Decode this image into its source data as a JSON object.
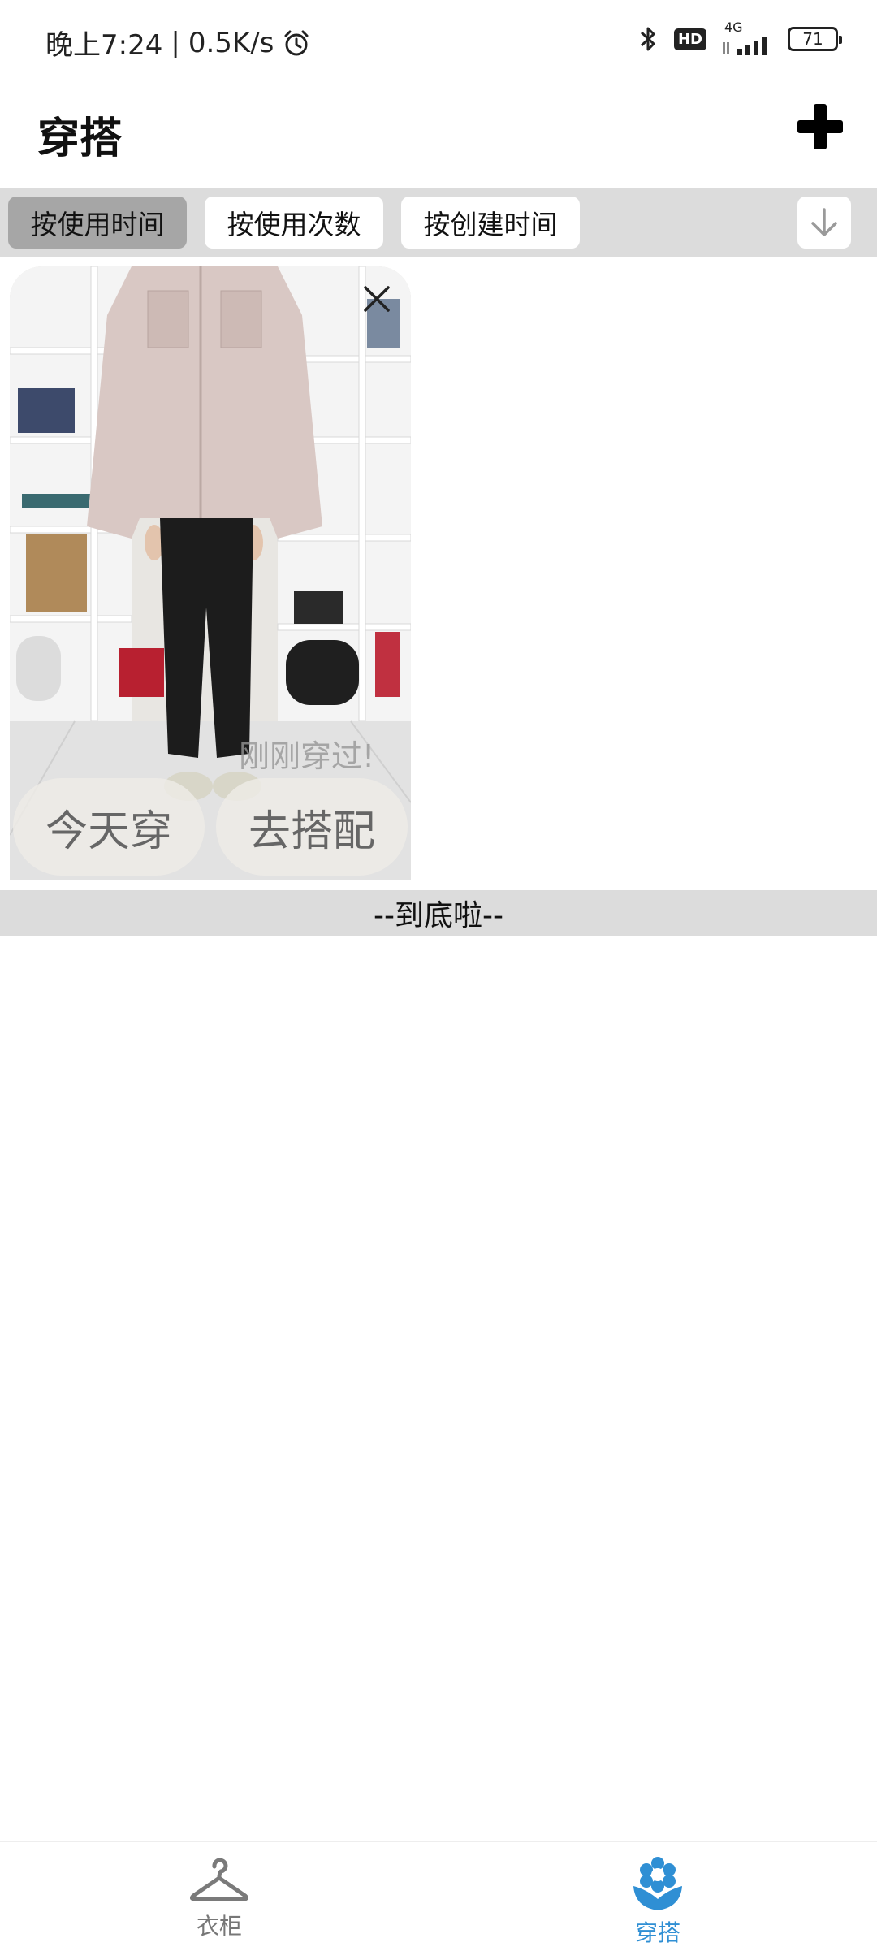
{
  "status_bar": {
    "time": "晚上7:24",
    "net_speed": "0.5K/s",
    "hd": "HD",
    "network": "4G",
    "battery": "71"
  },
  "header": {
    "title": "穿搭"
  },
  "sort_tabs": [
    {
      "label": "按使用时间",
      "active": true
    },
    {
      "label": "按使用次数",
      "active": false
    },
    {
      "label": "按创建时间",
      "active": false
    }
  ],
  "outfit_card": {
    "status": "刚刚穿过!",
    "wear_today_label": "今天穿",
    "match_label": "去搭配"
  },
  "list_end": "--到底啦--",
  "bottom_nav": {
    "wardrobe_label": "衣柜",
    "outfit_label": "穿搭"
  },
  "colors": {
    "accent": "#2f8fd4",
    "sort_bar_bg": "#dcdcdc",
    "active_tab": "#a6a6a6"
  }
}
